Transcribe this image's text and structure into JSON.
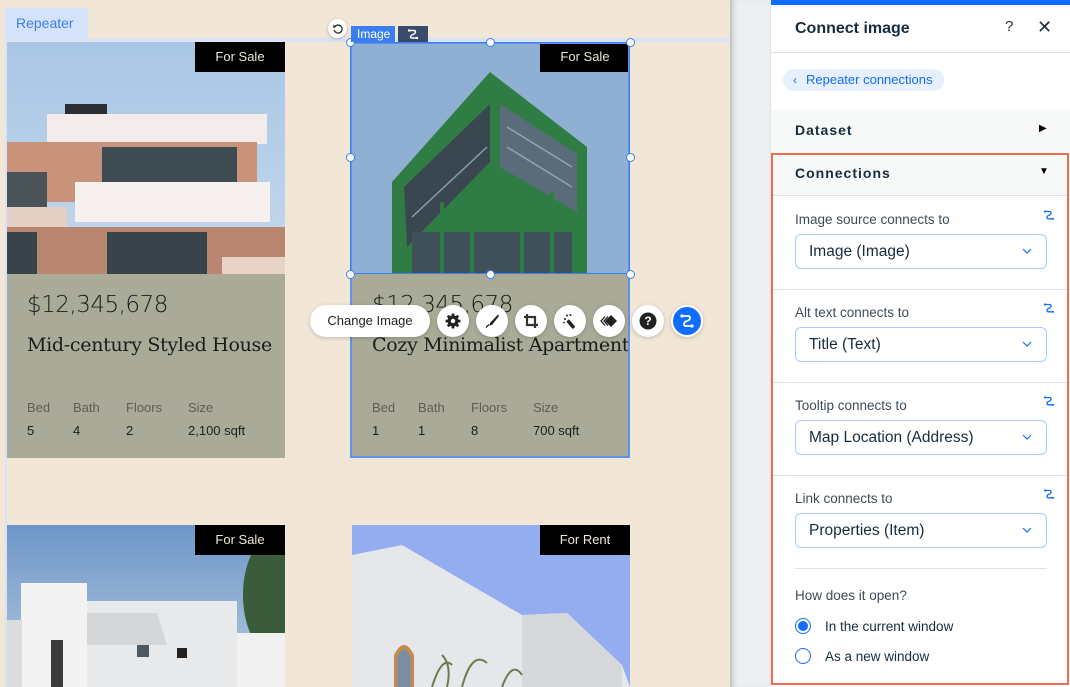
{
  "canvas": {
    "repeater_label": "Repeater",
    "selected_element_label": "Image",
    "cards": [
      {
        "badge": "For Sale",
        "price": "$12,345,678",
        "title": "Mid-century Styled House",
        "specs": [
          {
            "label": "Bed",
            "value": "5"
          },
          {
            "label": "Bath",
            "value": "4"
          },
          {
            "label": "Floors",
            "value": "2"
          },
          {
            "label": "Size",
            "value": "2,100 sqft"
          }
        ]
      },
      {
        "badge": "For Sale",
        "price": "$12,345,678",
        "title": "Cozy Minimalist Apartment",
        "specs": [
          {
            "label": "Bed",
            "value": "1"
          },
          {
            "label": "Bath",
            "value": "1"
          },
          {
            "label": "Floors",
            "value": "8"
          },
          {
            "label": "Size",
            "value": "700 sqft"
          }
        ]
      },
      {
        "badge": "For Sale"
      },
      {
        "badge": "For Rent"
      }
    ],
    "toolbar": {
      "change_image_label": "Change Image",
      "buttons": [
        "settings-icon",
        "design-brush-icon",
        "crop-icon",
        "enhance-wand-icon",
        "animation-icon",
        "help-icon",
        "connect-data-icon"
      ]
    }
  },
  "panel": {
    "title": "Connect image",
    "help_glyph": "?",
    "close_glyph": "✕",
    "back_link": "Repeater connections",
    "sections": {
      "dataset": "Dataset",
      "connections": "Connections"
    },
    "fields": [
      {
        "label": "Image source connects to",
        "value": "Image (Image)"
      },
      {
        "label": "Alt text connects to",
        "value": "Title (Text)"
      },
      {
        "label": "Tooltip connects to",
        "value": "Map Location (Address)"
      },
      {
        "label": "Link connects to",
        "value": "Properties (Item)"
      }
    ],
    "open_question": "How does it open?",
    "open_options": [
      {
        "label": "In the current window",
        "selected": true
      },
      {
        "label": "As a new window",
        "selected": false
      }
    ],
    "colors": {
      "accent": "#116dff",
      "highlight_frame": "#f26b4f",
      "card_info_bg": "#aaaa98",
      "canvas_bg": "#f2e6d7"
    }
  }
}
